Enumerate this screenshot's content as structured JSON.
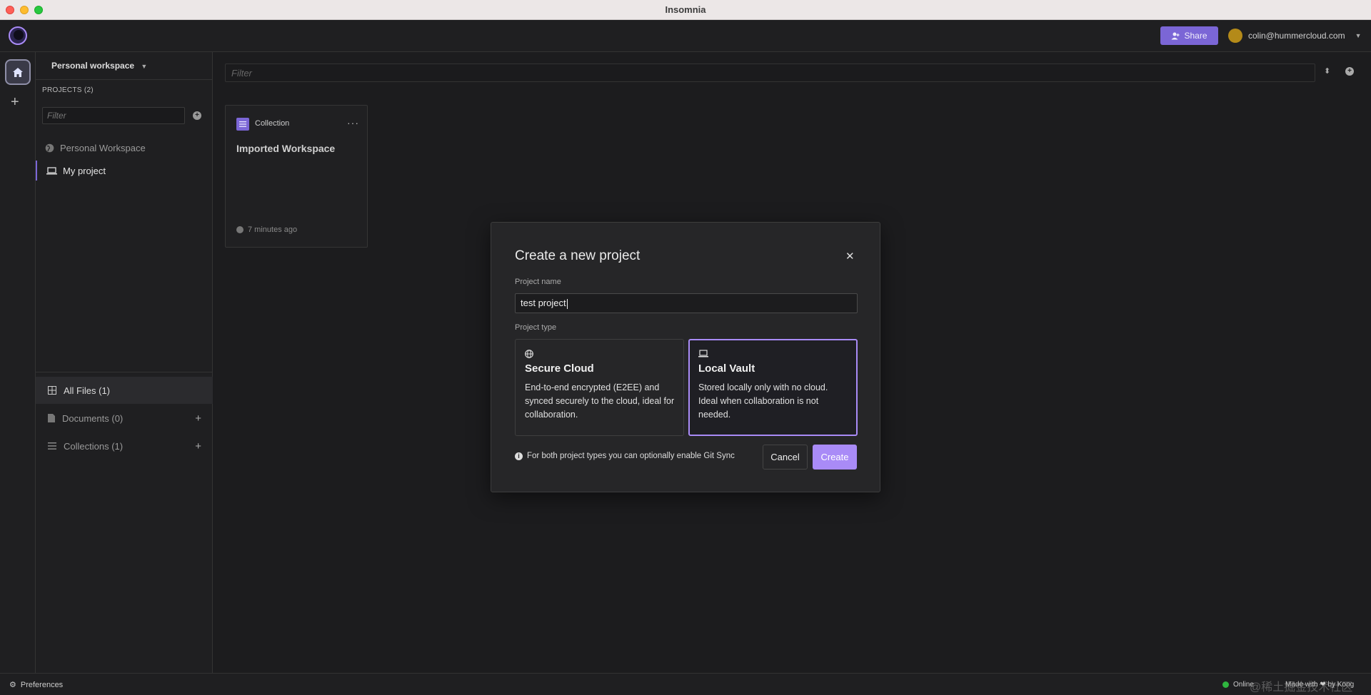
{
  "window": {
    "title": "Insomnia"
  },
  "header": {
    "share_label": "Share",
    "user_email": "colin@hummercloud.com"
  },
  "sidebar": {
    "workspace_switcher": "Personal workspace",
    "projects_label": "PROJECTS (2)",
    "filter_placeholder": "Filter",
    "projects": [
      {
        "label": "Personal Workspace"
      },
      {
        "label": "My project"
      }
    ],
    "nav": [
      {
        "label": "All Files (1)"
      },
      {
        "label": "Documents (0)"
      },
      {
        "label": "Collections (1)"
      }
    ]
  },
  "main": {
    "filter_placeholder": "Filter",
    "cards": [
      {
        "type_label": "Collection",
        "title": "Imported Workspace",
        "updated": "7 minutes ago"
      }
    ]
  },
  "modal": {
    "title": "Create a new project",
    "name_label": "Project name",
    "name_value": "test project",
    "type_label": "Project type",
    "options": [
      {
        "title": "Secure Cloud",
        "description": "End-to-end encrypted (E2EE) and synced securely to the cloud, ideal for collaboration.",
        "selected": false
      },
      {
        "title": "Local Vault",
        "description": "Stored locally only with no cloud. Ideal when collaboration is not needed.",
        "selected": true
      }
    ],
    "note": "For both project types you can optionally enable Git Sync",
    "cancel_label": "Cancel",
    "create_label": "Create"
  },
  "statusbar": {
    "preferences_label": "Preferences",
    "online_label": "Online",
    "made_with_label": "Made with ❤ by Kong",
    "watermark": "@稀土掘金技术社区"
  },
  "colors": {
    "accent": "#a98bf7",
    "share": "#7b66d6",
    "online": "#2fb53f"
  }
}
